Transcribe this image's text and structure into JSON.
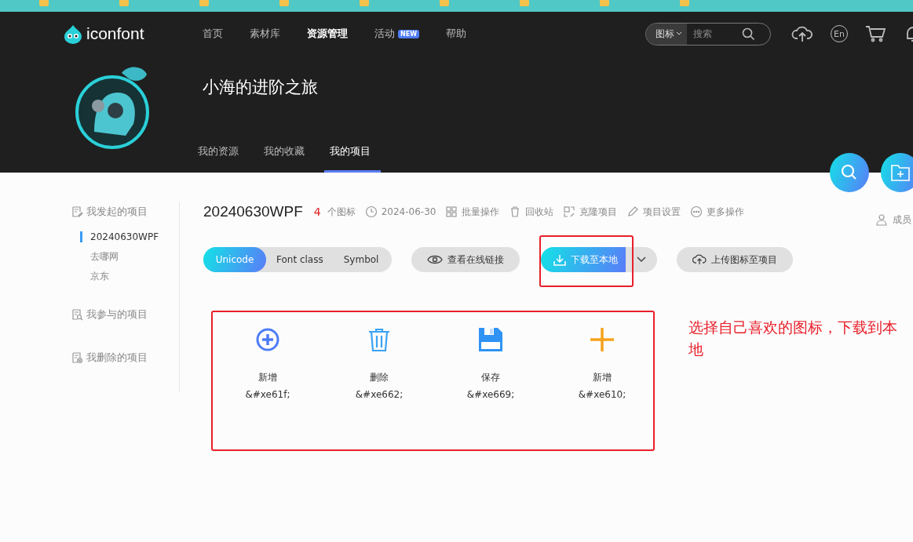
{
  "header": {
    "logo": "iconfont",
    "nav": [
      {
        "label": "首页",
        "selected": false
      },
      {
        "label": "素材库",
        "selected": false
      },
      {
        "label": "资源管理",
        "selected": true
      },
      {
        "label": "活动",
        "selected": false,
        "badge": "NEW"
      },
      {
        "label": "帮助",
        "selected": false
      }
    ],
    "search": {
      "scope": "图标",
      "placeholder": "搜索"
    },
    "lang": "En"
  },
  "profile": {
    "name": "小海的进阶之旅",
    "tabs": [
      {
        "label": "我的资源",
        "selected": false
      },
      {
        "label": "我的收藏",
        "selected": false
      },
      {
        "label": "我的项目",
        "selected": true
      }
    ]
  },
  "sidebar": [
    {
      "label": "我发起的项目",
      "kind": "edit",
      "children": [
        {
          "label": "20240630WPF",
          "selected": true
        },
        {
          "label": "去哪网",
          "selected": false
        },
        {
          "label": "京东",
          "selected": false
        }
      ]
    },
    {
      "label": "我参与的项目",
      "kind": "search"
    },
    {
      "label": "我删除的项目",
      "kind": "delete"
    }
  ],
  "project": {
    "name": "20240630WPF",
    "count": "4",
    "count_unit": "个图标",
    "date": "2024-06-30",
    "actions": [
      {
        "label": "批量操作",
        "kind": "batch"
      },
      {
        "label": "回收站",
        "kind": "recycle"
      },
      {
        "label": "克隆项目",
        "kind": "clone"
      },
      {
        "label": "项目设置",
        "kind": "settings"
      },
      {
        "label": "更多操作",
        "kind": "more"
      }
    ],
    "members": "成员"
  },
  "modes": [
    {
      "label": "Unicode",
      "selected": true
    },
    {
      "label": "Font class",
      "selected": false
    },
    {
      "label": "Symbol",
      "selected": false
    }
  ],
  "buttons": {
    "view_link": "查看在线链接",
    "download": "下载至本地",
    "upload": "上传图标至项目"
  },
  "icons": [
    {
      "name": "新增",
      "code": "&#xe61f;",
      "kind": "circle-plus",
      "color": "#4e7cf6"
    },
    {
      "name": "删除",
      "code": "&#xe662;",
      "kind": "trash",
      "color": "#3ba2f5"
    },
    {
      "name": "保存",
      "code": "&#xe669;",
      "kind": "save",
      "color": "#2f93f5"
    },
    {
      "name": "新增",
      "code": "&#xe610;",
      "kind": "plus",
      "color": "#f7a21b"
    }
  ],
  "annotation": "选择自己喜欢的图标，下载到本地"
}
